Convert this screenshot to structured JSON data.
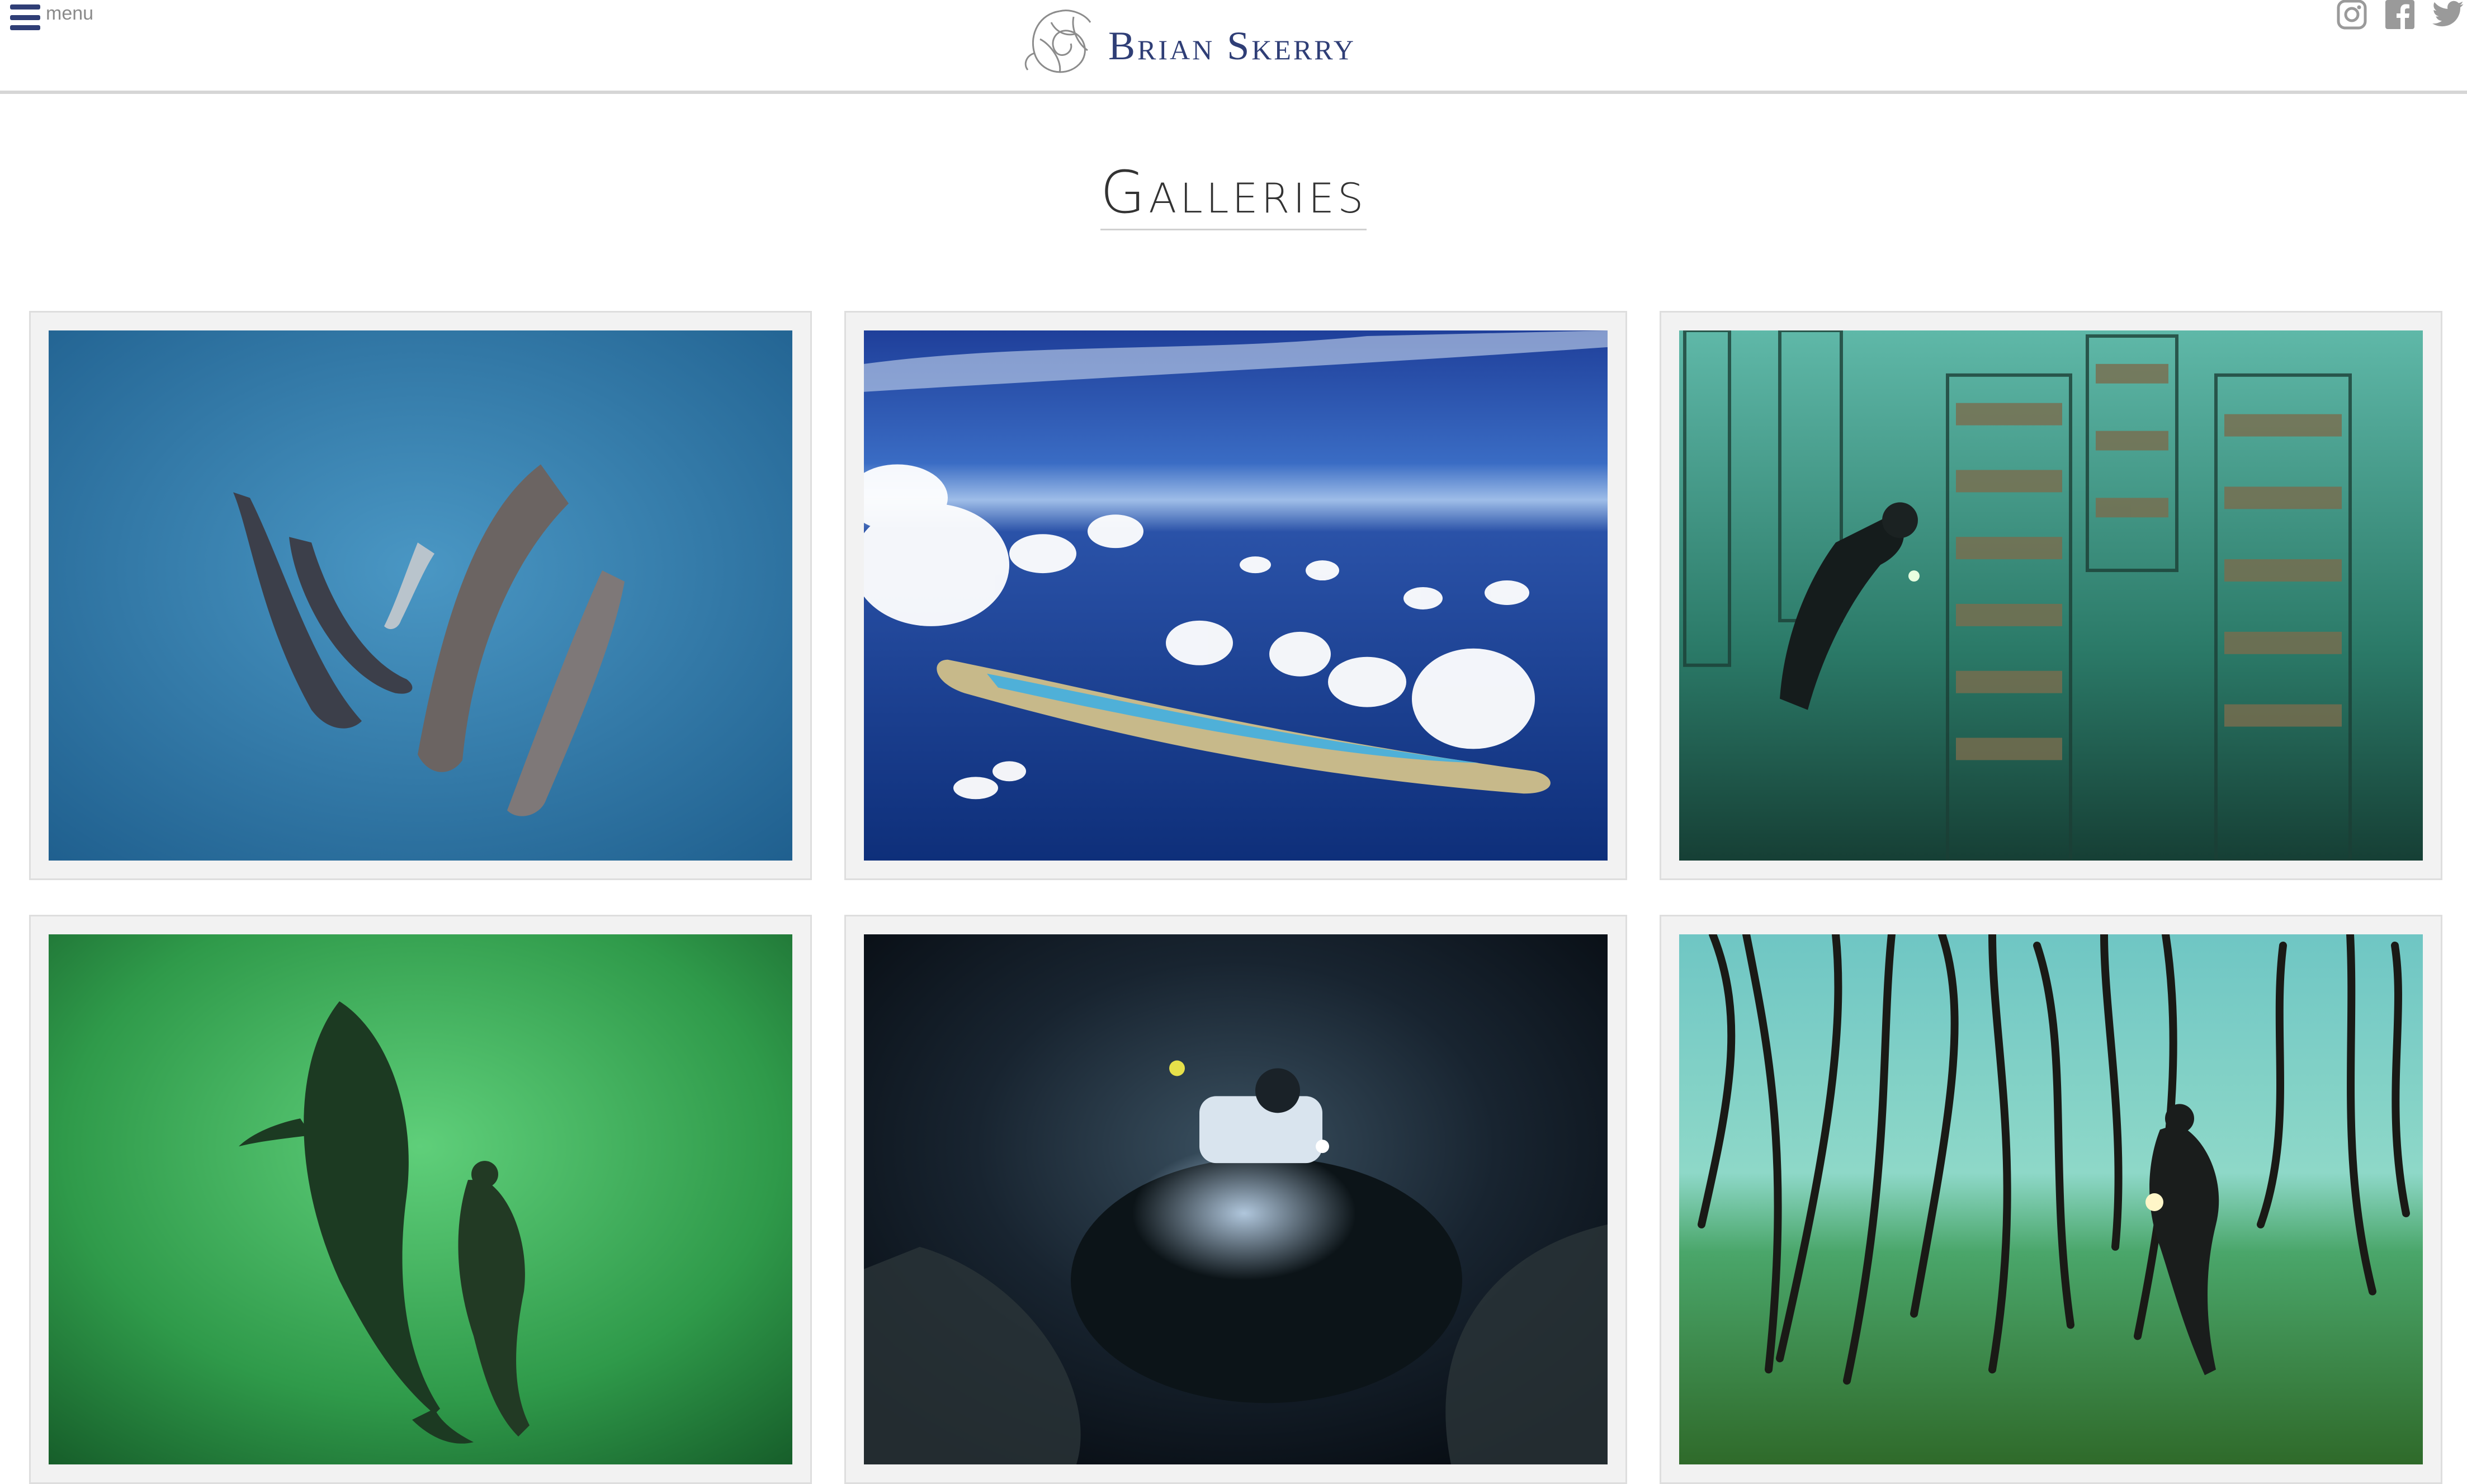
{
  "header": {
    "menu_label": "menu",
    "logo_text": "Brian Skerry",
    "social": [
      {
        "icon": "instagram-icon"
      },
      {
        "icon": "facebook-icon"
      },
      {
        "icon": "twitter-icon"
      }
    ]
  },
  "page": {
    "title": "Galleries"
  },
  "galleries": [
    {
      "image": "dolphins-image"
    },
    {
      "image": "atoll-aerial-image"
    },
    {
      "image": "diver-scallop-cages-image"
    },
    {
      "image": "whale-diver-image"
    },
    {
      "image": "submersible-image"
    },
    {
      "image": "mangrove-roots-image"
    }
  ],
  "colors": {
    "brand": "#2f3e76",
    "menu_text": "#8a8a8a",
    "card_bg": "#f2f2f2",
    "icon_gray": "#9a9a9a"
  }
}
